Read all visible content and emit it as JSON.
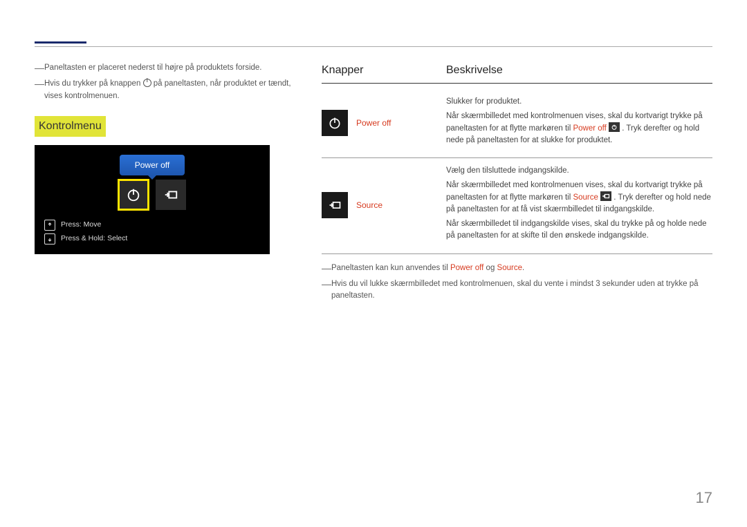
{
  "left": {
    "line1": "Paneltasten er placeret nederst til højre på produktets forside.",
    "line2_a": "Hvis du trykker på knappen ",
    "line2_b": " på paneltasten, når produktet er tændt, vises kontrolmenuen.",
    "section_title": "Kontrolmenu",
    "tooltip": "Power off",
    "hint1": "Press: Move",
    "hint2": "Press & Hold: Select"
  },
  "table": {
    "header1": "Knapper",
    "header2": "Beskrivelse",
    "rows": [
      {
        "label": "Power off",
        "desc_p1": "Slukker for produktet.",
        "desc_p2a": "Når skærmbilledet med kontrolmenuen vises, skal du kortvarigt trykke på paneltasten for at flytte markøren til ",
        "desc_p2_hi": "Power off",
        "desc_p2b": " . Tryk derefter og hold nede på paneltasten for at slukke for produktet."
      },
      {
        "label": "Source",
        "desc_p1": "Vælg den tilsluttede indgangskilde.",
        "desc_p2a": "Når skærmbilledet med kontrolmenuen vises, skal du kortvarigt trykke på paneltasten for at flytte markøren til ",
        "desc_p2_hi": "Source",
        "desc_p2b": " . Tryk derefter og hold nede på paneltasten for at få vist skærmbilledet til indgangskilde.",
        "desc_p3": "Når skærmbilledet til indgangskilde vises, skal du trykke på og holde nede på paneltasten for at skifte til den ønskede indgangskilde."
      }
    ]
  },
  "notes": {
    "n1a": "Paneltasten kan kun anvendes til ",
    "n1_p": "Power off",
    "n1_and": " og ",
    "n1_s": "Source",
    "n1_end": ".",
    "n2": "Hvis du vil lukke skærmbilledet med kontrolmenuen, skal du vente i mindst 3 sekunder uden at trykke på paneltasten."
  },
  "page_number": "17"
}
